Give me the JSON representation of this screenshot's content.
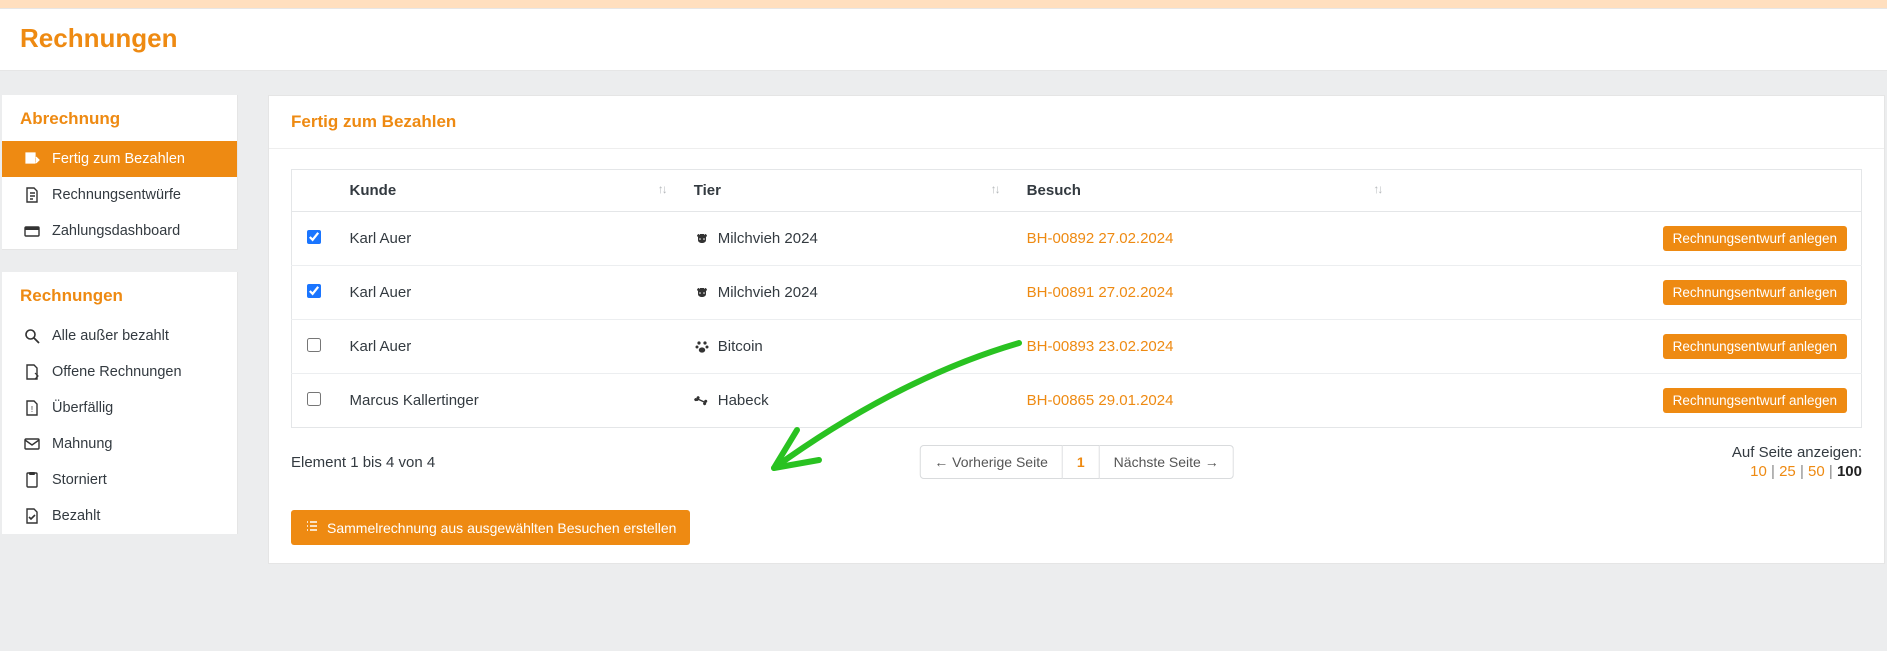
{
  "header": {
    "title": "Rechnungen"
  },
  "sidebar": {
    "group_billing": {
      "title": "Abrechnung",
      "items": [
        {
          "label": "Fertig zum Bezahlen"
        },
        {
          "label": "Rechnungsentwürfe"
        },
        {
          "label": "Zahlungsdashboard"
        }
      ]
    },
    "group_invoices": {
      "title": "Rechnungen",
      "items": [
        {
          "label": "Alle außer bezahlt"
        },
        {
          "label": "Offene Rechnungen"
        },
        {
          "label": "Überfällig"
        },
        {
          "label": "Mahnung"
        },
        {
          "label": "Storniert"
        },
        {
          "label": "Bezahlt"
        }
      ]
    }
  },
  "panel": {
    "title": "Fertig zum Bezahlen",
    "columns": {
      "kunde": "Kunde",
      "tier": "Tier",
      "besuch": "Besuch"
    },
    "rows": [
      {
        "checked": true,
        "kunde": "Karl Auer",
        "tier": "Milchvieh 2024",
        "tier_icon": "cow",
        "besuch": "BH-00892 27.02.2024",
        "action": "Rechnungsentwurf anlegen"
      },
      {
        "checked": true,
        "kunde": "Karl Auer",
        "tier": "Milchvieh 2024",
        "tier_icon": "cow",
        "besuch": "BH-00891 27.02.2024",
        "action": "Rechnungsentwurf anlegen"
      },
      {
        "checked": false,
        "kunde": "Karl Auer",
        "tier": "Bitcoin",
        "tier_icon": "paw",
        "besuch": "BH-00893 23.02.2024",
        "action": "Rechnungsentwurf anlegen"
      },
      {
        "checked": false,
        "kunde": "Marcus Kallertinger",
        "tier": "Habeck",
        "tier_icon": "bone",
        "besuch": "BH-00865 29.01.2024",
        "action": "Rechnungsentwurf anlegen"
      }
    ],
    "element_count": "Element 1 bis 4 von 4",
    "pager": {
      "prev": "← Vorherige Seite",
      "current": "1",
      "next": "Nächste Seite →"
    },
    "page_size": {
      "label": "Auf Seite anzeigen:",
      "opts": [
        "10",
        "25",
        "50"
      ],
      "active": "100"
    },
    "bulk_button": "Sammelrechnung aus ausgewählten Besuchen erstellen"
  }
}
